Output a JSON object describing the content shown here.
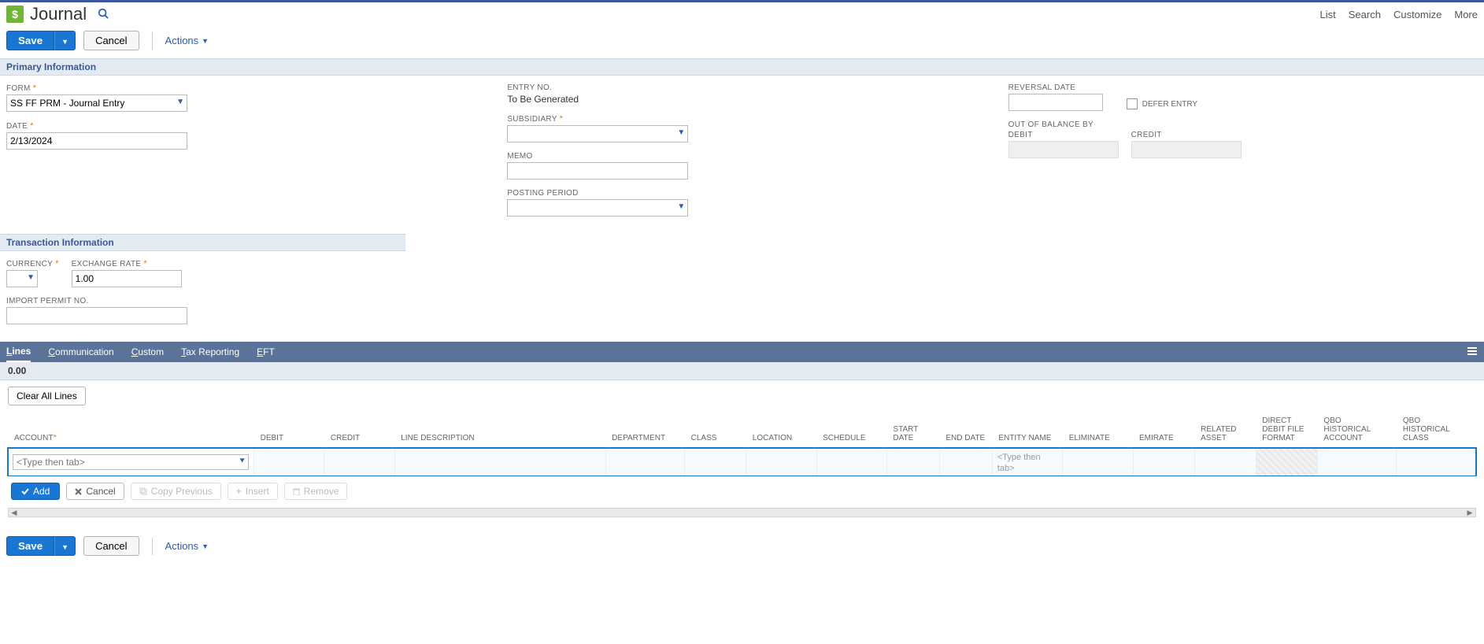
{
  "header": {
    "title": "Journal",
    "links": [
      "List",
      "Search",
      "Customize",
      "More"
    ]
  },
  "buttons": {
    "save": "Save",
    "cancel": "Cancel",
    "actions": "Actions",
    "clear_all": "Clear All Lines",
    "add": "Add",
    "row_cancel": "Cancel",
    "copy_prev": "Copy Previous",
    "insert": "Insert",
    "remove": "Remove"
  },
  "sections": {
    "primary": "Primary Information",
    "transaction": "Transaction Information"
  },
  "primary": {
    "form_label": "FORM",
    "form_value": "SS FF PRM - Journal Entry",
    "date_label": "DATE",
    "date_value": "2/13/2024",
    "entryno_label": "ENTRY NO.",
    "entryno_value": "To Be Generated",
    "subsidiary_label": "SUBSIDIARY",
    "subsidiary_value": "",
    "memo_label": "MEMO",
    "memo_value": "",
    "posting_label": "POSTING PERIOD",
    "posting_value": "",
    "reversal_label": "REVERSAL DATE",
    "reversal_value": "",
    "defer_label": "DEFER ENTRY",
    "oob_label": "OUT OF BALANCE BY",
    "debit_label": "DEBIT",
    "credit_label": "CREDIT",
    "debit_value": "",
    "credit_value": ""
  },
  "transaction": {
    "currency_label": "CURRENCY",
    "currency_value": "",
    "exrate_label": "EXCHANGE RATE",
    "exrate_value": "1.00",
    "import_label": "IMPORT PERMIT NO.",
    "import_value": ""
  },
  "tabs": {
    "t1": "ines",
    "t1p": "L",
    "t2": "ommunication",
    "t2p": "C",
    "t3": "ustom",
    "t3p": "C",
    "t4": "ax Reporting",
    "t4p": "T",
    "t5": "FT",
    "t5p": "E"
  },
  "lines": {
    "total": "0.00",
    "columns": {
      "account": "ACCOUNT",
      "debit": "DEBIT",
      "credit": "CREDIT",
      "linedesc": "LINE DESCRIPTION",
      "dept": "DEPARTMENT",
      "class": "CLASS",
      "location": "LOCATION",
      "schedule": "SCHEDULE",
      "startdate": "START DATE",
      "enddate": "END DATE",
      "entity": "ENTITY NAME",
      "eliminate": "ELIMINATE",
      "emirate": "EMIRATE",
      "related": "RELATED ASSET",
      "ddff": "DIRECT DEBIT FILE FORMAT",
      "qboha": "QBO HISTORICAL ACCOUNT",
      "qbohc": "QBO HISTORICAL CLASS"
    },
    "row": {
      "account_ph": "<Type then tab>",
      "entity_ph": "<Type then tab>"
    }
  }
}
